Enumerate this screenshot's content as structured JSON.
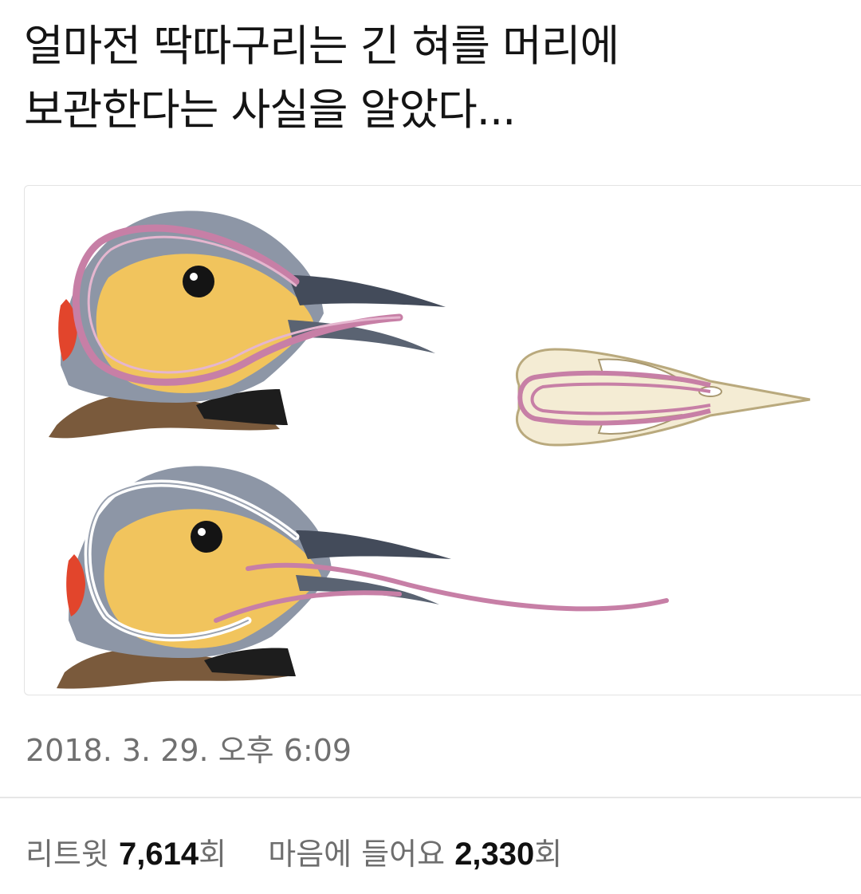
{
  "tweet": {
    "text_line_1": "얼마전 딱따구리는 긴 혀를 머리에",
    "text_line_2": "보관한다는 사실을 알았다..."
  },
  "timestamp": "2018. 3. 29. 오후 6:09",
  "stats": {
    "retweet_label": "리트윗",
    "retweet_count": "7,614",
    "retweet_unit": "회",
    "like_label": "마음에 들어요",
    "like_count": "2,330",
    "like_unit": "회"
  },
  "colors": {
    "tongue": "#c77fa6",
    "bird_gray": "#8a93a3",
    "bird_yellow": "#f0c25a",
    "bird_red": "#e2452c",
    "beak": "#3f4654",
    "skull": "#f4ecd4"
  },
  "icons": [
    "woodpecker-illustration-tongue-retracted",
    "woodpecker-illustration-tongue-extended",
    "woodpecker-skull-icon"
  ]
}
